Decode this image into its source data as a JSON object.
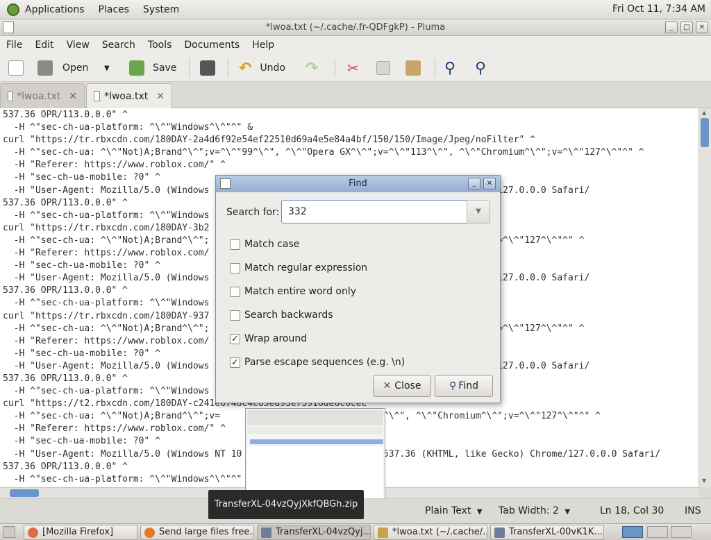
{
  "top_panel": {
    "menus": [
      "Applications",
      "Places",
      "System"
    ],
    "clock": "Fri Oct 11,  7:34 AM"
  },
  "window": {
    "title": "*lwoa.txt (~/.cache/.fr-QDFgkP) - Pluma"
  },
  "menubar": [
    "File",
    "Edit",
    "View",
    "Search",
    "Tools",
    "Documents",
    "Help"
  ],
  "toolbar": {
    "open_label": "Open",
    "save_label": "Save",
    "undo_label": "Undo"
  },
  "tabs": [
    {
      "label": "*lwoa.txt",
      "active": false
    },
    {
      "label": "*lwoa.txt",
      "active": true
    }
  ],
  "editor": {
    "lines": [
      "537.36 OPR/113.0.0.0\" ^",
      "  -H ^\"sec-ch-ua-platform: ^\\^\"Windows^\\^\"^\" &",
      "curl \"https://tr.rbxcdn.com/180DAY-2a4d6f92e54ef22510d69a4e5e84a4bf/150/150/Image/Jpeg/noFilter\" ^",
      "  -H ^\"sec-ch-ua: ^\\^\"Not)A;Brand^\\^\";v=^\\^\"99^\\^\", ^\\^\"Opera GX^\\^\";v=^\\^\"113^\\^\", ^\\^\"Chromium^\\^\";v=^\\^\"127^\\^\"^\" ^",
      "  -H \"Referer: https://www.roblox.com/\" ^",
      "  -H \"sec-ch-ua-mobile: ?0\" ^",
      "  -H \"User-Agent: Mozilla/5.0 (Windows                                    ke Gecko) Chrome/127.0.0.0 Safari/",
      "537.36 OPR/113.0.0.0\" ^",
      "  -H ^\"sec-ch-ua-platform: ^\\^\"Windows",
      "curl \"https://tr.rbxcdn.com/180DAY-3b2                                          ilter\" ^",
      "  -H ^\"sec-ch-ua: ^\\^\"Not)A;Brand^\\^\";                                        hromium^\\^\";v=^\\^\"127^\\^\"^\" ^",
      "  -H \"Referer: https://www.roblox.com/",
      "  -H \"sec-ch-ua-mobile: ?0\" ^",
      "  -H \"User-Agent: Mozilla/5.0 (Windows                                    ke Gecko) Chrome/127.0.0.0 Safari/",
      "537.36 OPR/113.0.0.0\" ^",
      "  -H ^\"sec-ch-ua-platform: ^\\^\"Windows",
      "curl \"https://tr.rbxcdn.com/180DAY-937                                          ilter\" ^",
      "  -H ^\"sec-ch-ua: ^\\^\"Not)A;Brand^\\^\";                                        hromium^\\^\";v=^\\^\"127^\\^\"^\" ^",
      "  -H \"Referer: https://www.roblox.com/",
      "  -H \"sec-ch-ua-mobile: ?0\" ^",
      "  -H \"User-Agent: Mozilla/5.0 (Windows                                    ke Gecko) Chrome/127.0.0.0 Safari/",
      "537.36 OPR/113.0.0.0\" ^",
      "  -H ^\"sec-ch-ua-platform: ^\\^\"Windows",
      "curl \"https://t2.rbxcdn.com/180DAY-c241e6748c4c05ea93e73916de6c6cec\" ^",
      "  -H ^\"sec-ch-ua: ^\\^\"Not)A;Brand^\\^\";v=                     v=^\\^\"113^\\^\", ^\\^\"Chromium^\\^\";v=^\\^\"127^\\^\"^\" ^",
      "  -H \"Referer: https://www.roblox.com/\" ^",
      "  -H \"sec-ch-ua-mobile: ?0\" ^",
      "  -H \"User-Agent: Mozilla/5.0 (Windows NT 10                       it/537.36 (KHTML, like Gecko) Chrome/127.0.0.0 Safari/",
      "537.36 OPR/113.0.0.0\" ^",
      "  -H ^\"sec-ch-ua-platform: ^\\^\"Windows^\\^\"^\""
    ]
  },
  "find_dialog": {
    "title": "Find",
    "search_label": "Search for:",
    "search_value": "332",
    "options": [
      {
        "label": "Match case",
        "checked": false
      },
      {
        "label": "Match regular expression",
        "checked": false
      },
      {
        "label": "Match entire word only",
        "checked": false
      },
      {
        "label": "Search backwards",
        "checked": false
      },
      {
        "label": "Wrap around",
        "checked": true
      },
      {
        "label": "Parse escape sequences (e.g. \\n)",
        "checked": true
      }
    ],
    "close_label": "Close",
    "find_label": "Find"
  },
  "statusbar": {
    "language": "Plain Text",
    "tab_width": "Tab Width: 2",
    "position": "Ln 18, Col 30",
    "mode": "INS"
  },
  "tooltip": {
    "text": "TransferXL-04vzQyjXkfQBGh.zip"
  },
  "taskbar": [
    {
      "label": "[Mozilla Firefox]",
      "color": "#e06c4a"
    },
    {
      "label": "Send large files free...",
      "color": "#e5782c"
    },
    {
      "label": "TransferXL-04vzQyj...",
      "color": "#6d7f98"
    },
    {
      "label": "*lwoa.txt (~/.cache/....",
      "color": "#c9a349"
    },
    {
      "label": "TransferXL-00vK1K...",
      "color": "#6d7f98"
    }
  ]
}
